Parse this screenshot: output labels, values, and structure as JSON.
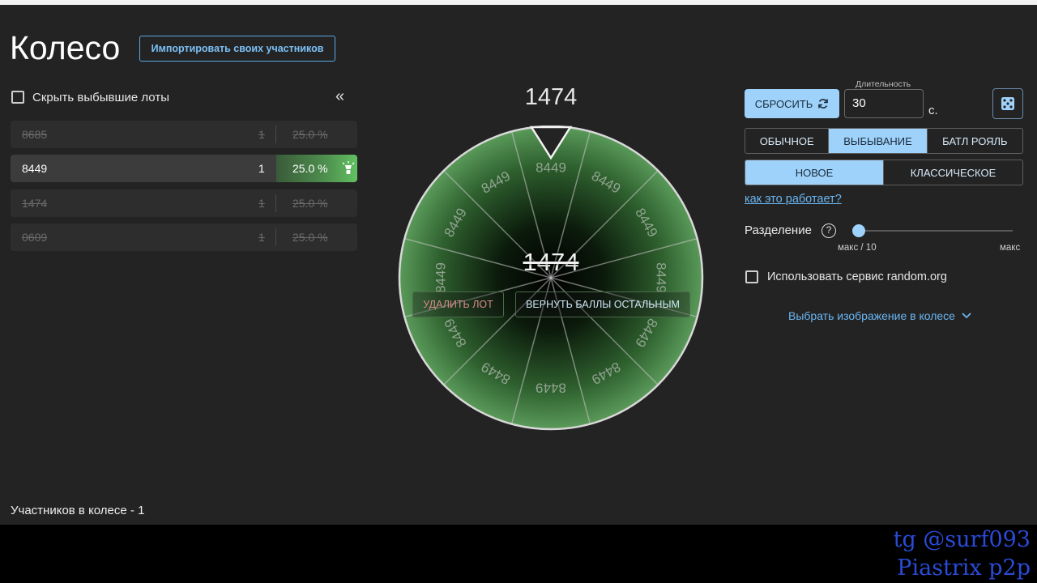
{
  "header": {
    "title": "Колесо",
    "import_label": "Импортировать своих участников"
  },
  "sidebar": {
    "hide_label": "Скрыть выбывшие лоты",
    "collapse_icon": "«",
    "lots": [
      {
        "name": "8685",
        "amount": "1",
        "percent": "25.0 %",
        "eliminated": true
      },
      {
        "name": "8449",
        "amount": "1",
        "percent": "25.0 %",
        "eliminated": false
      },
      {
        "name": "1474",
        "amount": "1",
        "percent": "25.0 %",
        "eliminated": true
      },
      {
        "name": "0609",
        "amount": "1",
        "percent": "25.0 %",
        "eliminated": true
      }
    ],
    "participants": "Участников в колесе - 1"
  },
  "wheel": {
    "winner_top": "1474",
    "center_name": "1474",
    "slice_label": "8449",
    "slice_count": 12,
    "delete_label": "УДАЛИТЬ ЛОТ",
    "return_label": "ВЕРНУТЬ БАЛЛЫ ОСТАЛЬНЫМ",
    "colors": {
      "slice": "#5a9a5a",
      "edge": "#d8d8d8"
    }
  },
  "controls": {
    "reset_label": "СБРОСИТЬ",
    "duration_label": "Длительность",
    "duration_value": "30",
    "duration_unit": "с.",
    "modes": [
      {
        "label": "ОБЫЧНОЕ",
        "active": false
      },
      {
        "label": "ВЫБЫВАНИЕ",
        "active": true
      },
      {
        "label": "БАТЛ РОЯЛЬ",
        "active": false
      }
    ],
    "types": [
      {
        "label": "НОВОЕ",
        "active": true
      },
      {
        "label": "КЛАССИЧЕСКОЕ",
        "active": false
      }
    ],
    "how_link": "как это работает?",
    "split_label": "Разделение",
    "split_min": "макс / 10",
    "split_max": "макс",
    "split_value": 0,
    "random_org_label": "Использовать сервис random.org",
    "image_select_label": "Выбрать изображение в колесе"
  },
  "overlay": {
    "line1": "tg @surf093",
    "line2": "Piastrix p2p"
  }
}
